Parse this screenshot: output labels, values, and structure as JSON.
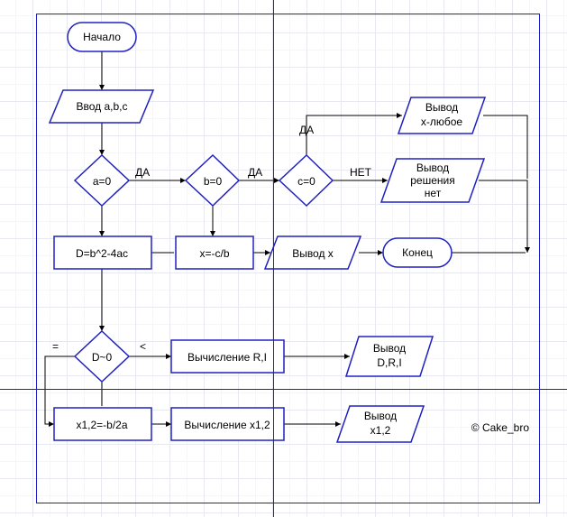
{
  "nodes": {
    "start": {
      "text": "Начало"
    },
    "input": {
      "text": "Ввод a,b,c"
    },
    "a0": {
      "text": "a=0"
    },
    "b0": {
      "text": "b=0"
    },
    "c0": {
      "text": "c=0"
    },
    "out_any": {
      "l1": "Вывод",
      "l2": "x-любое"
    },
    "out_none": {
      "l1": "Вывод",
      "l2": "решения",
      "l3": "нет"
    },
    "calcD": {
      "text": "D=b^2-4ac"
    },
    "xcb": {
      "text": "x=-c/b"
    },
    "out_x": {
      "text": "Вывод x"
    },
    "end": {
      "text": "Конец"
    },
    "d0": {
      "text": "D~0"
    },
    "calcRI": {
      "text": "Вычисление R,I"
    },
    "out_DRI": {
      "l1": "Вывод",
      "l2": "D,R,I"
    },
    "x12": {
      "text": "x1,2=-b/2a"
    },
    "calcX12": {
      "text": "Вычисление x1,2"
    },
    "out_x12": {
      "l1": "Вывод",
      "l2": "x1,2"
    }
  },
  "labels": {
    "da": "ДА",
    "net": "НЕТ",
    "lt": "<",
    "eq": "="
  },
  "watermark": "© Cake_bro"
}
